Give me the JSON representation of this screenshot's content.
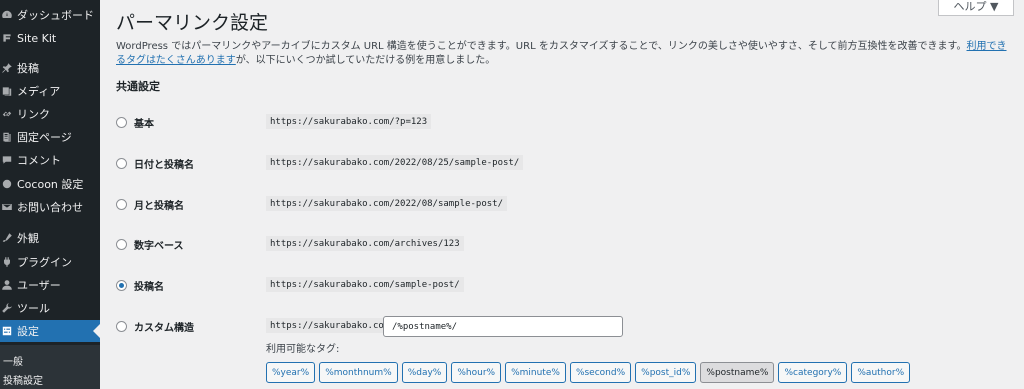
{
  "sidebar": {
    "items": [
      {
        "label": "ダッシュボード",
        "icon": "dashboard-icon"
      },
      {
        "label": "Site Kit",
        "icon": "site-kit-icon"
      },
      {
        "label": "投稿",
        "icon": "pin-icon"
      },
      {
        "label": "メディア",
        "icon": "media-icon"
      },
      {
        "label": "リンク",
        "icon": "link-icon"
      },
      {
        "label": "固定ページ",
        "icon": "page-icon"
      },
      {
        "label": "コメント",
        "icon": "comment-icon"
      },
      {
        "label": "Cocoon 設定",
        "icon": "cocoon-icon"
      },
      {
        "label": "お問い合わせ",
        "icon": "mail-icon"
      },
      {
        "label": "外観",
        "icon": "appearance-icon"
      },
      {
        "label": "プラグイン",
        "icon": "plugin-icon"
      },
      {
        "label": "ユーザー",
        "icon": "user-icon"
      },
      {
        "label": "ツール",
        "icon": "wrench-icon"
      },
      {
        "label": "設定",
        "icon": "settings-icon"
      }
    ],
    "submenu": [
      "一般",
      "投稿設定"
    ]
  },
  "help": {
    "label": "ヘルプ ▼"
  },
  "page": {
    "title": "パーマリンク設定",
    "intro_text": "WordPress ではパーマリンクやアーカイブにカスタム URL 構造を使うことができます。URL をカスタマイズすることで、リンクの美しさや使いやすさ、そして前方互換性を改善できます。",
    "intro_link": "利用できるタグはたくさんあります",
    "intro_text2": "が、以下にいくつか試していただける例を用意しました。",
    "section_title": "共通設定"
  },
  "options": [
    {
      "label": "基本",
      "example": "https://sakurabako.com/?p=123",
      "checked": false
    },
    {
      "label": "日付と投稿名",
      "example": "https://sakurabako.com/2022/08/25/sample-post/",
      "checked": false
    },
    {
      "label": "月と投稿名",
      "example": "https://sakurabako.com/2022/08/sample-post/",
      "checked": false
    },
    {
      "label": "数字ベース",
      "example": "https://sakurabako.com/archives/123",
      "checked": false
    },
    {
      "label": "投稿名",
      "example": "https://sakurabako.com/sample-post/",
      "checked": true
    },
    {
      "label": "カスタム構造",
      "example": "https://sakurabako.com",
      "checked": false
    }
  ],
  "custom": {
    "value": "/%postname%/",
    "tags_label": "利用可能なタグ:",
    "tags": [
      "%year%",
      "%monthnum%",
      "%day%",
      "%hour%",
      "%minute%",
      "%second%",
      "%post_id%",
      "%postname%",
      "%category%",
      "%author%"
    ],
    "selected_tag": "%postname%"
  }
}
